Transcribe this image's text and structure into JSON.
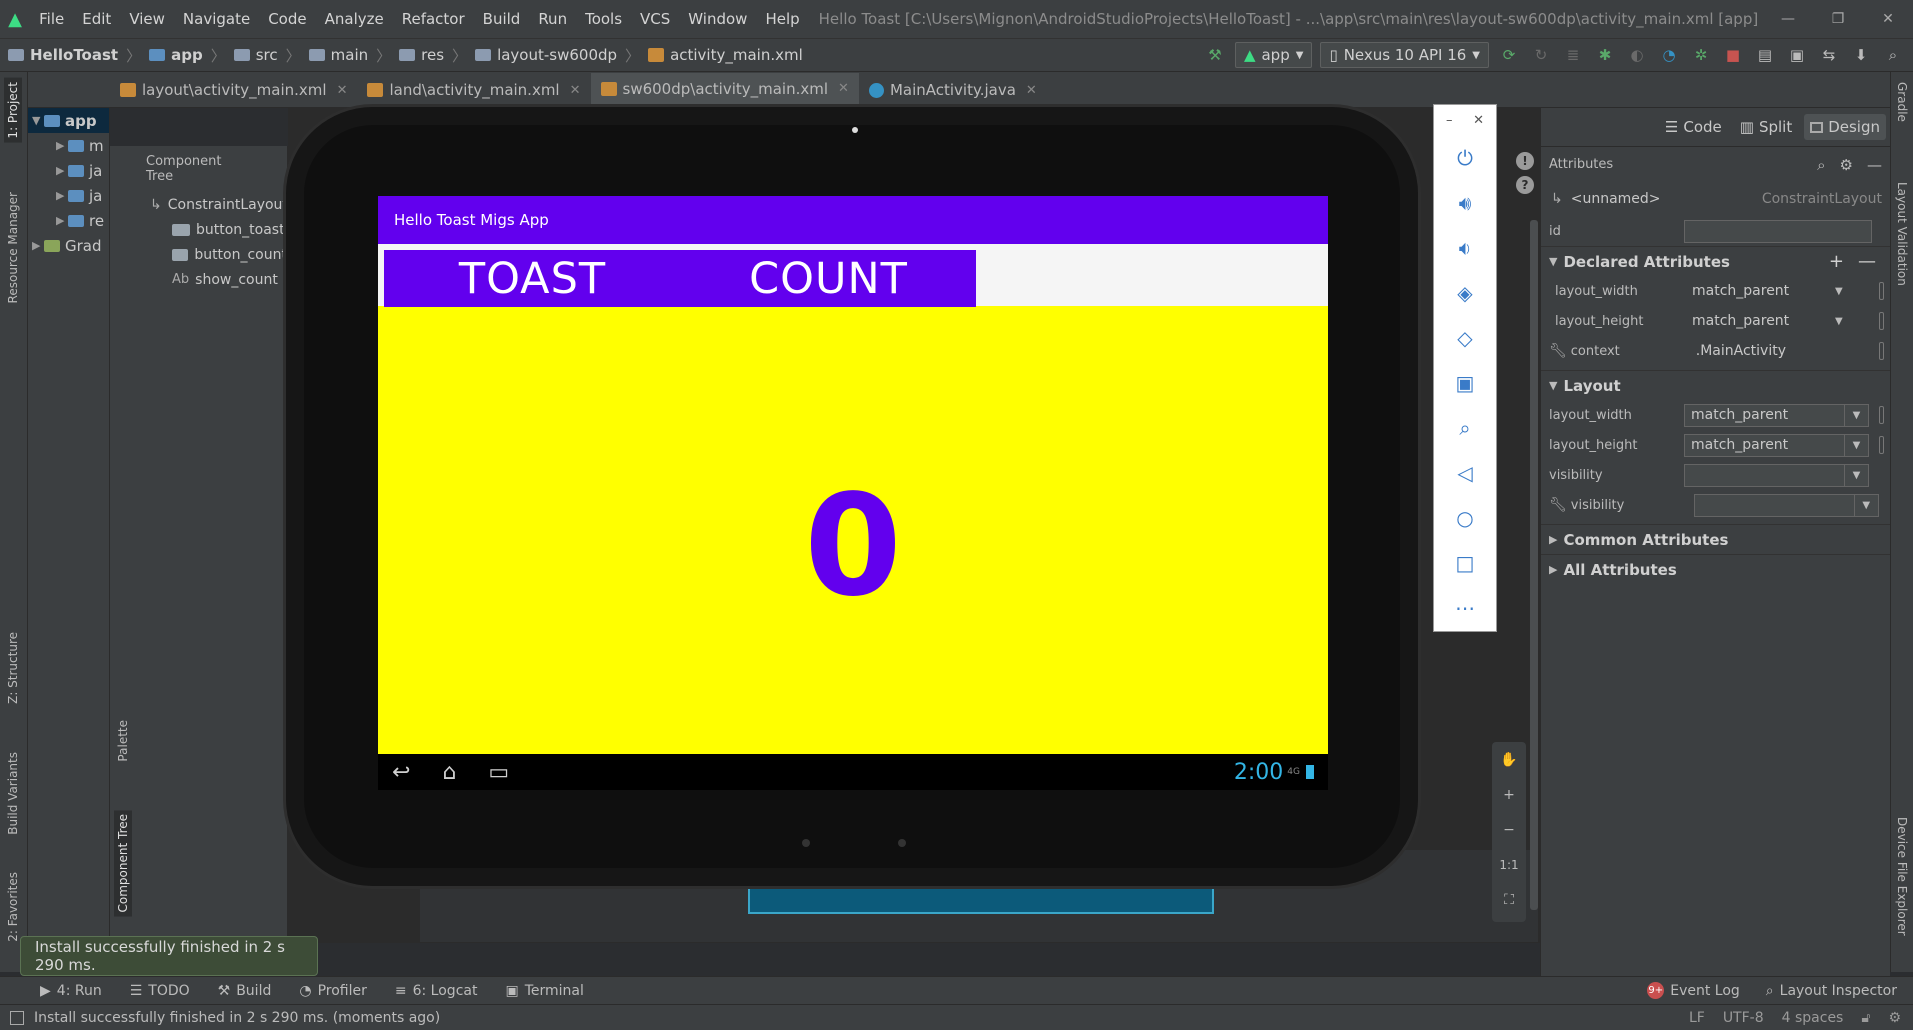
{
  "menubar": {
    "items": [
      "File",
      "Edit",
      "View",
      "Navigate",
      "Code",
      "Analyze",
      "Refactor",
      "Build",
      "Run",
      "Tools",
      "VCS",
      "Window",
      "Help"
    ],
    "window_title": "Hello Toast [C:\\Users\\Mignon\\AndroidStudioProjects\\HelloToast] - ...\\app\\src\\main\\res\\layout-sw600dp\\activity_main.xml [app] - Android Studio"
  },
  "breadcrumb": [
    "HelloToast",
    "app",
    "src",
    "main",
    "res",
    "layout-sw600dp",
    "activity_main.xml"
  ],
  "toolbar": {
    "run_config": "app",
    "device": "Nexus 10 API 16"
  },
  "editor_tabs": [
    {
      "label": "layout\\activity_main.xml",
      "type": "xml",
      "active": false
    },
    {
      "label": "land\\activity_main.xml",
      "type": "xml",
      "active": false
    },
    {
      "label": "sw600dp\\activity_main.xml",
      "type": "xml",
      "active": true
    },
    {
      "label": "MainActivity.java",
      "type": "java",
      "active": false
    }
  ],
  "left_stripe": {
    "project": "1: Project",
    "resource_manager": "Resource Manager",
    "structure": "Z: Structure",
    "build_variants": "Build Variants",
    "favorites": "2: Favorites"
  },
  "project_tree": [
    {
      "label": "app",
      "expanded": true,
      "selected": true
    },
    {
      "label": "m"
    },
    {
      "label": "ja"
    },
    {
      "label": "ja"
    },
    {
      "label": "re"
    },
    {
      "label": "Grad"
    }
  ],
  "component_tree": {
    "title": "Component Tree",
    "root": "ConstraintLayout",
    "children": [
      {
        "label": "button_toast",
        "icon": "button-icon"
      },
      {
        "label": "button_count",
        "icon": "button-icon"
      },
      {
        "label": "show_count",
        "icon": "text-icon"
      }
    ],
    "palette_tab": "Palette",
    "component_tree_tab": "Component Tree"
  },
  "device_preview": {
    "app_title": "Hello Toast Migs App",
    "button_toast": "TOAST",
    "button_count": "COUNT",
    "count_value": "0",
    "clock": "2:00",
    "network": "4G",
    "colors": {
      "primary": "#6200ee",
      "background": "#ffff00"
    }
  },
  "emulator_toolbar": [
    "power-icon",
    "volume-up-icon",
    "volume-down-icon",
    "rotate-left-icon",
    "rotate-right-icon",
    "camera-icon",
    "zoom-icon",
    "back-icon",
    "home-icon",
    "overview-icon",
    "more-icon"
  ],
  "zoom_controls": {
    "zoom_in": "+",
    "zoom_out": "−",
    "actual": "1:1"
  },
  "view_modes": {
    "code": "Code",
    "split": "Split",
    "design": "Design"
  },
  "attributes": {
    "title": "Attributes",
    "element_name": "<unnamed>",
    "element_class": "ConstraintLayout",
    "id_label": "id",
    "id_value": "",
    "declared": {
      "title": "Declared Attributes",
      "rows": [
        {
          "key": "layout_width",
          "value": "match_parent"
        },
        {
          "key": "layout_height",
          "value": "match_parent"
        },
        {
          "key": "context",
          "value": ".MainActivity"
        }
      ]
    },
    "layout": {
      "title": "Layout",
      "rows": [
        {
          "key": "layout_width",
          "value": "match_parent"
        },
        {
          "key": "layout_height",
          "value": "match_parent"
        },
        {
          "key": "visibility",
          "value": ""
        },
        {
          "key": "visibility",
          "value": ""
        }
      ]
    },
    "common": "Common Attributes",
    "all": "All Attributes"
  },
  "right_stripe": {
    "gradle": "Gradle",
    "layout_validation": "Layout Validation",
    "device_explorer": "Device File Explorer"
  },
  "tool_windows": [
    {
      "label": "4: Run",
      "icon": "run-icon"
    },
    {
      "label": "TODO",
      "icon": "todo-icon"
    },
    {
      "label": "Build",
      "icon": "build-icon"
    },
    {
      "label": "Profiler",
      "icon": "profiler-icon"
    },
    {
      "label": "6: Logcat",
      "icon": "logcat-icon"
    },
    {
      "label": "Terminal",
      "icon": "terminal-icon"
    }
  ],
  "tool_windows_right": {
    "event_log": "Event Log",
    "event_badge": "9+",
    "layout_inspector": "Layout Inspector"
  },
  "balloon": "Install successfully finished in 2 s 290 ms.",
  "status": {
    "message": "Install successfully finished in 2 s 290 ms. (moments ago)",
    "line_sep": "LF",
    "encoding": "UTF-8",
    "indent": "4 spaces"
  }
}
